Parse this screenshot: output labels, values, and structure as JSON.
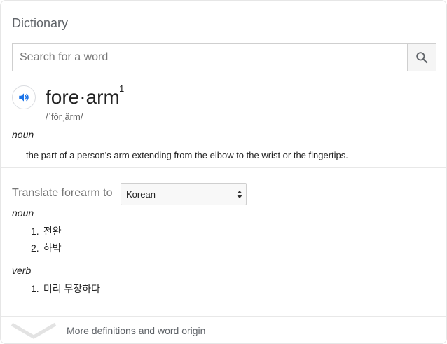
{
  "panel": {
    "title": "Dictionary"
  },
  "search": {
    "placeholder": "Search for a word",
    "value": ""
  },
  "entry": {
    "headword": "fore·arm",
    "homograph": "1",
    "pronunciation": "/ˈfôrˌärm/",
    "part_of_speech": "noun",
    "definition": "the part of a person's arm extending from the elbow to the wrist or the fingertips."
  },
  "translate": {
    "label": "Translate forearm to",
    "selected_language": "Korean",
    "groups": [
      {
        "pos": "noun",
        "items": [
          {
            "num": "1.",
            "text": "전완"
          },
          {
            "num": "2.",
            "text": "하박"
          }
        ]
      },
      {
        "pos": "verb",
        "items": [
          {
            "num": "1.",
            "text": "미리 무장하다"
          }
        ]
      }
    ]
  },
  "footer": {
    "more_label": "More definitions and word origin"
  },
  "colors": {
    "accent": "#1a73e8",
    "muted_text": "#777777",
    "border": "#cfcfcf"
  },
  "icons": {
    "search": "search-icon",
    "audio": "speaker-icon",
    "expand": "chevron-down-icon",
    "select": "select-arrows-icon"
  }
}
